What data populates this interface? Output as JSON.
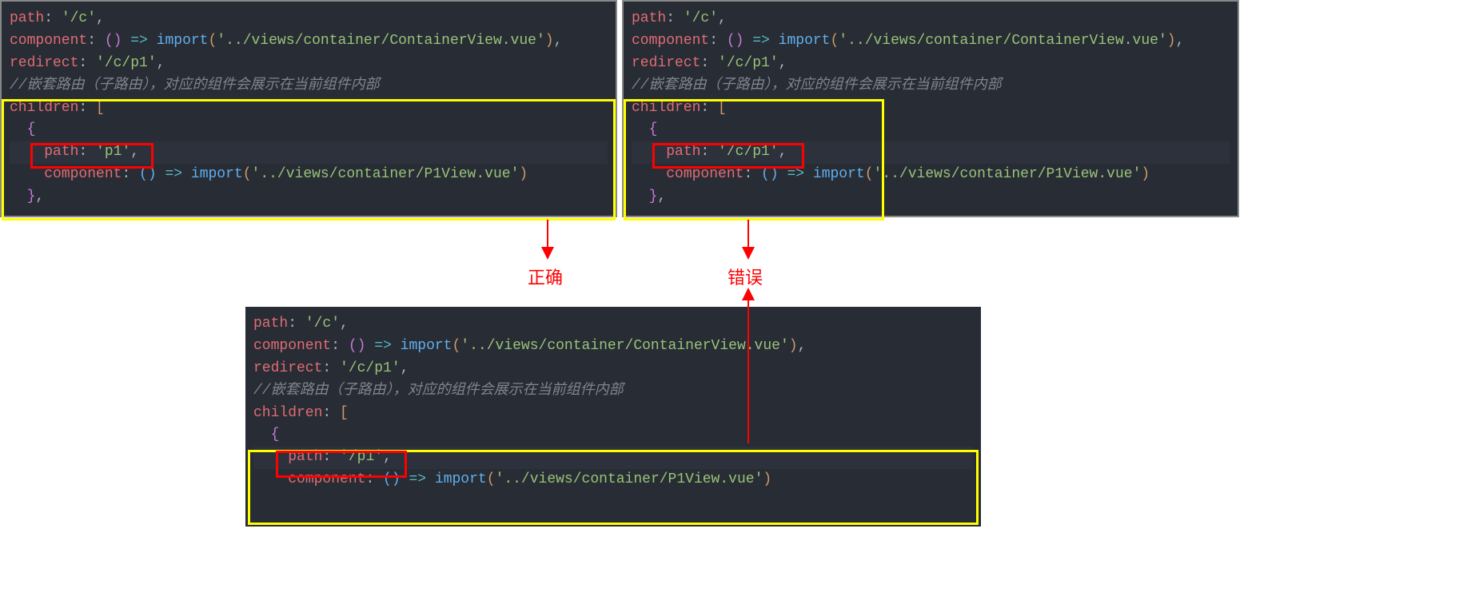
{
  "block1": {
    "path_kw": "path",
    "path_val": "'/c'",
    "comp_kw": "component",
    "import_kw": "import",
    "comp_val": "'../views/container/ContainerView.vue'",
    "redir_kw": "redirect",
    "redir_val": "'/c/p1'",
    "comment": "//嵌套路由（子路由），对应的组件会展示在当前组件内部",
    "children_kw": "children",
    "child_path_kw": "path",
    "child_path_val": "'p1'",
    "child_comp_kw": "component",
    "child_import_kw": "import",
    "child_comp_val": "'../views/container/P1View.vue'"
  },
  "block2": {
    "path_kw": "path",
    "path_val": "'/c'",
    "comp_kw": "component",
    "import_kw": "import",
    "comp_val": "'../views/container/ContainerView.vue'",
    "redir_kw": "redirect",
    "redir_val": "'/c/p1'",
    "comment": "//嵌套路由（子路由），对应的组件会展示在当前组件内部",
    "children_kw": "children",
    "child_path_kw": "path",
    "child_path_val": "'/c/p1'",
    "child_comp_kw": "component",
    "child_import_kw": "import",
    "child_comp_val": "'../views/container/P1View.vue'"
  },
  "block3": {
    "path_kw": "path",
    "path_val": "'/c'",
    "comp_kw": "component",
    "import_kw": "import",
    "comp_val": "'../views/container/ContainerView.vue'",
    "redir_kw": "redirect",
    "redir_val": "'/c/p1'",
    "comment": "//嵌套路由（子路由），对应的组件会展示在当前组件内部",
    "children_kw": "children",
    "child_path_kw": "path",
    "child_path_val": "'/p1'",
    "child_comp_kw": "component",
    "child_import_kw": "import",
    "child_comp_val": "'../views/container/P1View.vue'"
  },
  "labels": {
    "correct": "正确",
    "wrong": "错误"
  }
}
